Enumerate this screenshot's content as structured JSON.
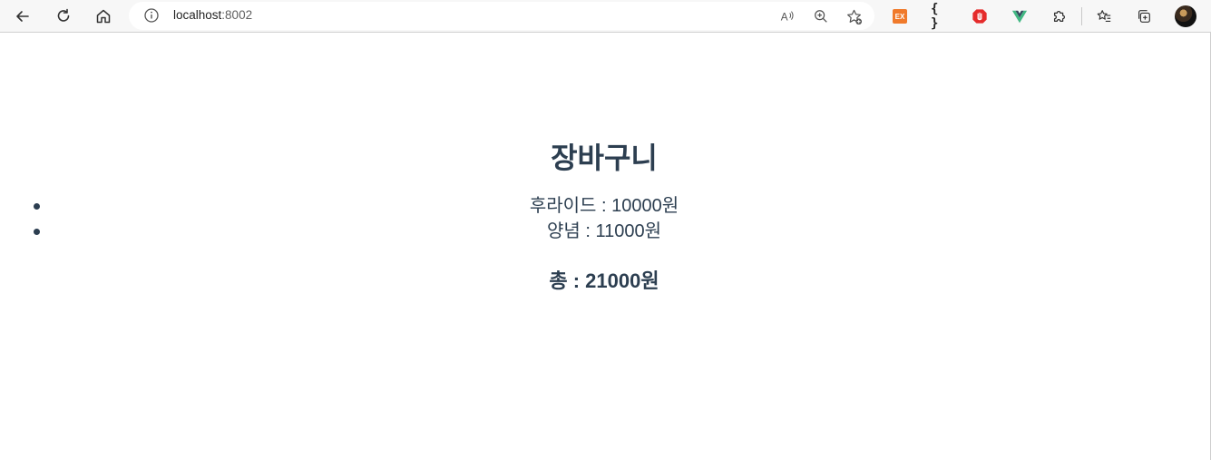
{
  "browser": {
    "address": "localhost",
    "port": ":8002",
    "icons": {
      "back": "back-arrow-icon",
      "reload": "reload-icon",
      "home": "home-icon",
      "info": "info-icon",
      "read_aloud": "read-aloud-icon",
      "zoom": "zoom-icon",
      "favorite": "add-favorite-icon",
      "ext1": "extension-orange-icon",
      "ext2": "json-braces-icon",
      "ext3": "adblock-icon",
      "ext4": "vue-devtools-icon",
      "extensions": "puzzle-icon",
      "favorites": "favorites-icon",
      "collections": "collections-icon",
      "profile": "profile-avatar"
    },
    "ext_label": "EX",
    "braces_label": "{ }"
  },
  "page": {
    "title": "장바구니",
    "items": [
      {
        "text": "후라이드 : 10000원"
      },
      {
        "text": "양념 : 11000원"
      }
    ],
    "total": "총 : 21000원"
  },
  "colors": {
    "text": "#2c3e50",
    "toolbar_bg": "#f7f7f7"
  }
}
